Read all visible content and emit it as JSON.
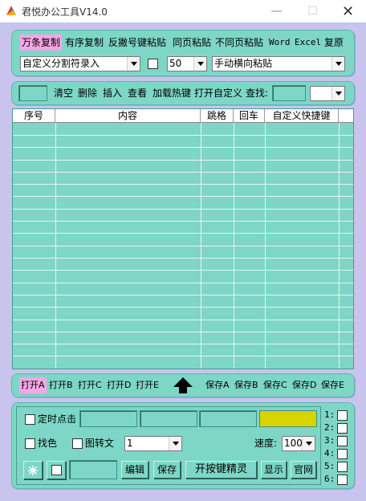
{
  "window": {
    "title": "君悦办公工具V14.0",
    "min_glyph": "—",
    "max_glyph": "☐",
    "close_glyph": "✕"
  },
  "toolbar1": {
    "buttons": [
      "万条复制",
      "有序复制",
      "反撇号键粘贴",
      "同页粘贴",
      "不同页粘贴",
      "Word",
      "Excel",
      "复原"
    ],
    "split_mode": "自定义分割符录入",
    "count_value": "50",
    "paste_mode": "手动横向粘贴"
  },
  "toolbar2": {
    "buttons": [
      "清空",
      "删除",
      "插入",
      "查看",
      "加载热键",
      "打开自定义"
    ],
    "search_label": "查找:"
  },
  "table": {
    "columns": [
      "序号",
      "内容",
      "跳格",
      "回车",
      "自定义快捷键"
    ]
  },
  "file_bar": {
    "open": [
      "打开A",
      "打开B",
      "打开C",
      "打开D",
      "打开E"
    ],
    "save": [
      "保存A",
      "保存B",
      "保存C",
      "保存D",
      "保存E"
    ]
  },
  "bottom": {
    "timer_label": "定时点击",
    "pick_color_label": "找色",
    "image_to_text_label": "图转文",
    "mode_value": "1",
    "speed_label": "速度:",
    "speed_value": "100",
    "edit_label": "编辑",
    "save_label": "保存",
    "wizard_label": "开按键精灵",
    "show_label": "显示",
    "website_label": "官网",
    "side_checks": [
      "1:",
      "2:",
      "3:",
      "4:",
      "5:",
      "6:"
    ],
    "color_swatch": "#d9d400"
  },
  "colors": {
    "panel": "#7ed6c6",
    "background": "#c8c4ee",
    "active_tab": "#f6a6e6"
  }
}
